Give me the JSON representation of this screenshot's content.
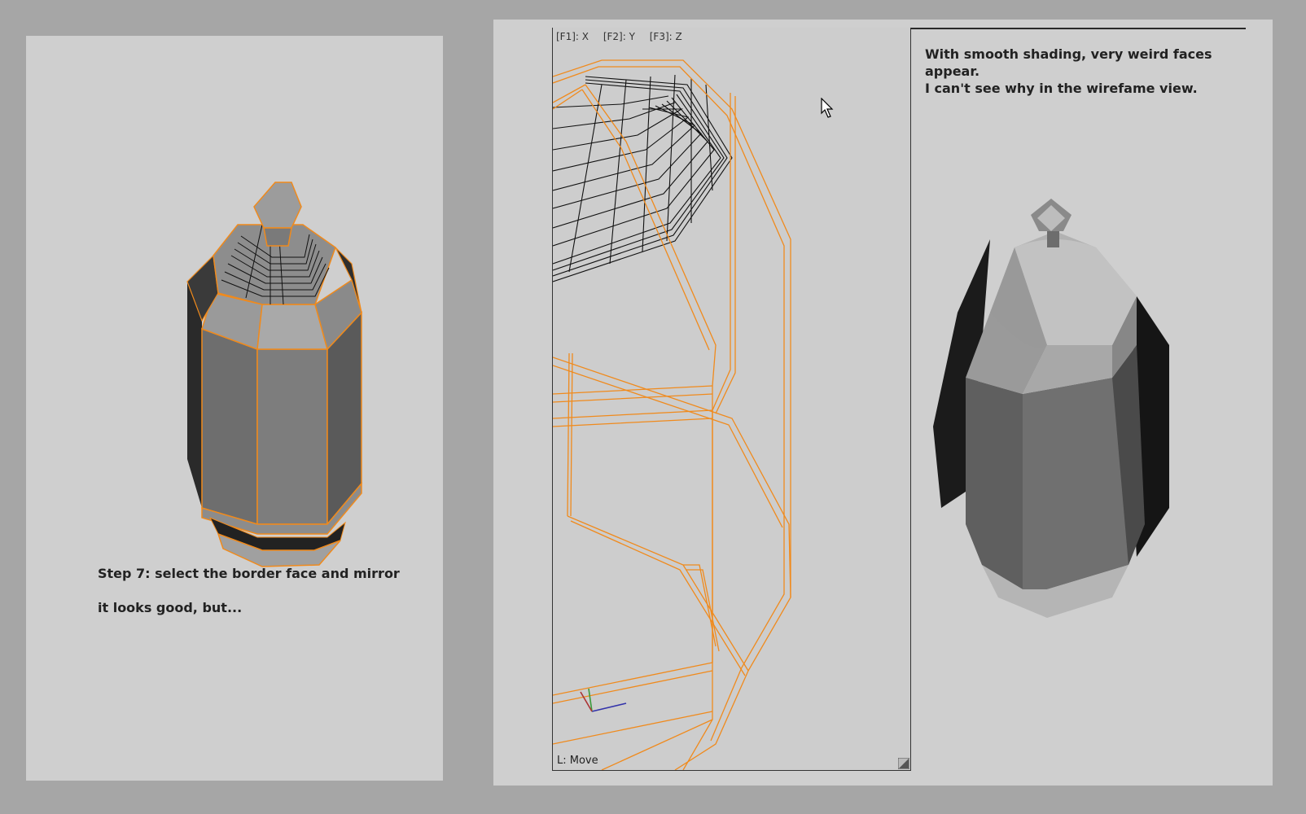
{
  "left_panel": {
    "caption_line1": "Step 7: select the border face and mirror",
    "caption_line2": "it looks good, but..."
  },
  "viewport": {
    "axis_tabs": [
      "[F1]: X",
      "[F2]: Y",
      "[F3]: Z"
    ],
    "status": "L: Move"
  },
  "right_panel": {
    "caption": "With smooth shading, very weird faces\nappear.\nI can't see why in the wirefame view."
  },
  "colors": {
    "background": "#a6a6a6",
    "panel": "#cfcfcf",
    "wire_selected": "#f08a1c",
    "wire_unselected": "#111111"
  }
}
